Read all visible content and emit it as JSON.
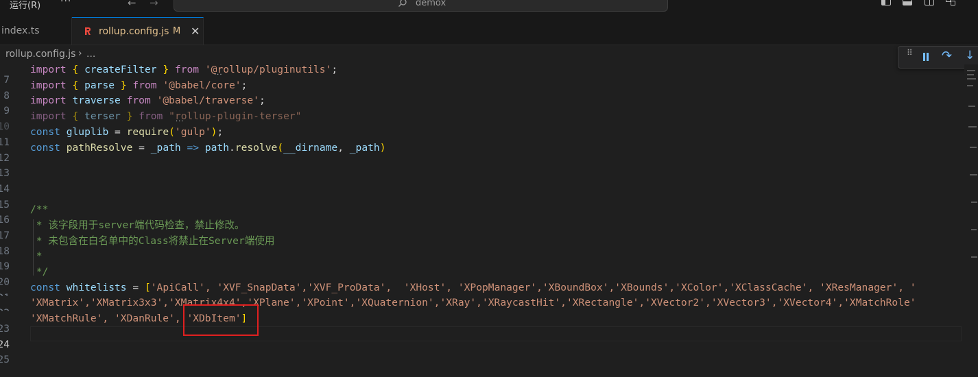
{
  "titlebar": {
    "menu_run": "运行(R)",
    "menu_more": "···",
    "back_arrow": "←",
    "forward_arrow": "→",
    "search_text": "demox"
  },
  "tabs": [
    {
      "label": "index.ts",
      "active": false
    },
    {
      "label": "rollup.config.js",
      "status": "M",
      "close": "✕",
      "active": true
    }
  ],
  "breadcrumb": {
    "file": "rollup.config.js",
    "sep": "›",
    "more": "..."
  },
  "debug_toolbar": {
    "grip": "⠿",
    "step_over": "↷",
    "step_into": "↓"
  },
  "editor": {
    "line_numbers": [
      "7",
      "8",
      "9",
      "10",
      "11",
      "12",
      "13",
      "14",
      "15",
      "16",
      "17",
      "18",
      "19",
      "20",
      "21",
      "22",
      "23",
      "24",
      "25"
    ],
    "active_line": "24",
    "lines": {
      "l7": {
        "import": "import",
        "lb": "{",
        "name": " createFilter ",
        "rb": "}",
        "from": "from",
        "src": "'@rollup/pluginutils'",
        "end": ";"
      },
      "l8": {
        "import": "import",
        "lb": "{",
        "name": " parse ",
        "rb": "}",
        "from": "from",
        "src": "'@babel/core'",
        "end": ";"
      },
      "l9": {
        "import": "import",
        "name": "traverse",
        "from": "from",
        "src": "'@babel/traverse'",
        "end": ";"
      },
      "l10": {
        "import": "import",
        "lb": "{",
        "name": " terser ",
        "rb": "}",
        "from": "from",
        "src": "\"rollup-plugin-terser\""
      },
      "l11": {
        "const": "const",
        "name": "gluplib",
        "eq": " = ",
        "fn": "require",
        "lp": "(",
        "src": "'gulp'",
        "rp": ")",
        "end": ";"
      },
      "l12": {
        "const": "const",
        "name": "pathResolve",
        "eq": " = ",
        "arg": "_path",
        "arrow": " => ",
        "obj": "path",
        "dot": ".",
        "fn": "resolve",
        "lp": "(",
        "a1": "__dirname",
        "comma": ", ",
        "a2": "_path",
        "rp": ")"
      },
      "l16": "/**",
      "l17": " * 该字段用于server端代码检查，禁止修改。",
      "l18": " * 未包含在白名单中的Class将禁止在Server端使用",
      "l19": " *",
      "l20": " */",
      "l21": {
        "const": "const",
        "name": "whitelists",
        "eq": " = ",
        "lb": "[",
        "items": "'ApiCall', 'XVF_SnapData','XVF_ProData',  'XHost', 'XPopManager','XBoundBox','XBounds','XColor','XClassCache', 'XResManager', '"
      },
      "l22": "'XMatrix','XMatrix3x3','XMatrix4x4','XPlane','XPoint','XQuaternion','XRay','XRaycastHit','XRectangle','XVector2','XVector3','XVector4','XMatchRole'",
      "l23": {
        "items": "'XMatchRule', 'XDanRule', 'XDbItem'",
        "rb": "]"
      }
    }
  }
}
